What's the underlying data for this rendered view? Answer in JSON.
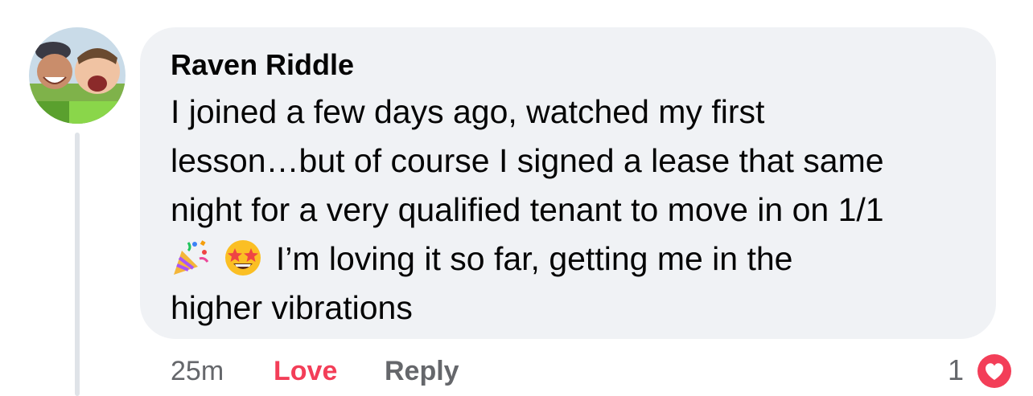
{
  "comment": {
    "author": "Raven Riddle",
    "text_lines": [
      "I joined a few days ago, watched my first",
      "lesson…but of course I signed a lease that same",
      "night for a very qualified tenant to move in on 1/1",
      "I’m loving it so far, getting me in the",
      "higher vibrations"
    ],
    "emojis": [
      "party-popper-icon",
      "star-struck-icon"
    ],
    "bubble_color": "#f0f2f5"
  },
  "actions": {
    "timestamp": "25m",
    "love_label": "Love",
    "reply_label": "Reply",
    "love_color": "#f33e58"
  },
  "reactions": {
    "count": "1",
    "type": "love-heart-icon",
    "color": "#f33e58"
  }
}
